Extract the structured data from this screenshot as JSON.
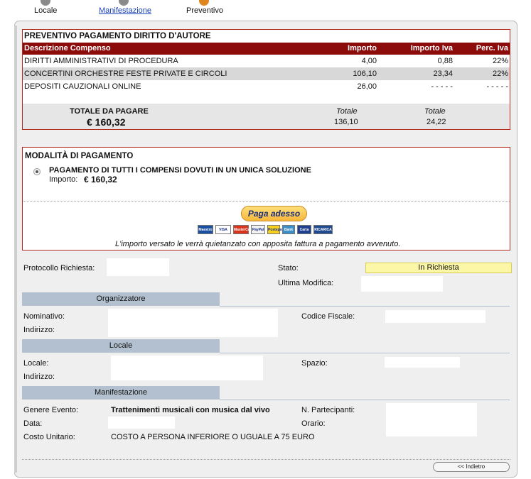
{
  "steps": {
    "locale": "Locale",
    "manifestazione": "Manifestazione",
    "preventivo": "Preventivo"
  },
  "quote": {
    "title": "PREVENTIVO PAGAMENTO DIRITTO D'AUTORE",
    "headers": {
      "desc": "Descrizione Compenso",
      "importo": "Importo",
      "importo_iva": "Importo Iva",
      "perc_iva": "Perc. Iva"
    },
    "rows": [
      {
        "desc": "DIRITTI AMMINISTRATIVI DI PROCEDURA",
        "importo": "4,00",
        "iva": "0,88",
        "perc": "22%"
      },
      {
        "desc": "CONCERTINI ORCHESTRE FESTE PRIVATE E CIRCOLI",
        "importo": "106,10",
        "iva": "23,34",
        "perc": "22%"
      },
      {
        "desc": "DEPOSITI CAUZIONALI ONLINE",
        "importo": "26,00",
        "iva": "- - - - -",
        "perc": "- - - - -"
      }
    ],
    "total_label": "TOTALE DA PAGARE",
    "total_amount": "€ 160,32",
    "totale_caption": "Totale",
    "totale_importo": "136,10",
    "totale_iva": "24,22"
  },
  "payment": {
    "title": "MODALITÀ DI PAGAMENTO",
    "option": "PAGAMENTO DI TUTTI I COMPENSI DOVUTI IN UN UNICA SOLUZIONE",
    "importo_label": "Importo:",
    "importo_value": "€ 160,32",
    "paypal_button": "Paga adesso",
    "cards": [
      "Maestro",
      "VISA",
      "MasterCard",
      "PayPal",
      "Postepay",
      "Bank",
      "Carta",
      "RICARICA PAYPAL"
    ],
    "note": "L'importo versato le verrà quietanzato con apposita fattura a pagamento avvenuto."
  },
  "details": {
    "protocollo_label": "Protocollo Richiesta:",
    "stato_label": "Stato:",
    "stato_value": "In Richiesta",
    "ultima_modifica_label": "Ultima Modifica:",
    "organizzatore": {
      "section": "Organizzatore",
      "nominativo_label": "Nominativo:",
      "indirizzo_label": "Indirizzo:",
      "codice_fiscale_label": "Codice Fiscale:"
    },
    "locale": {
      "section": "Locale",
      "locale_label": "Locale:",
      "indirizzo_label": "Indirizzo:",
      "spazio_label": "Spazio:"
    },
    "manifestazione": {
      "section": "Manifestazione",
      "genere_label": "Genere Evento:",
      "genere_value": "Trattenimenti musicali con musica dal vivo",
      "partecipanti_label": "N. Partecipanti:",
      "data_label": "Data:",
      "orario_label": "Orario:",
      "costo_label": "Costo Unitario:",
      "costo_value": "COSTO A PERSONA INFERIORE O UGUALE A 75 EURO"
    }
  },
  "footer": {
    "back_button": "<< Indietro"
  }
}
